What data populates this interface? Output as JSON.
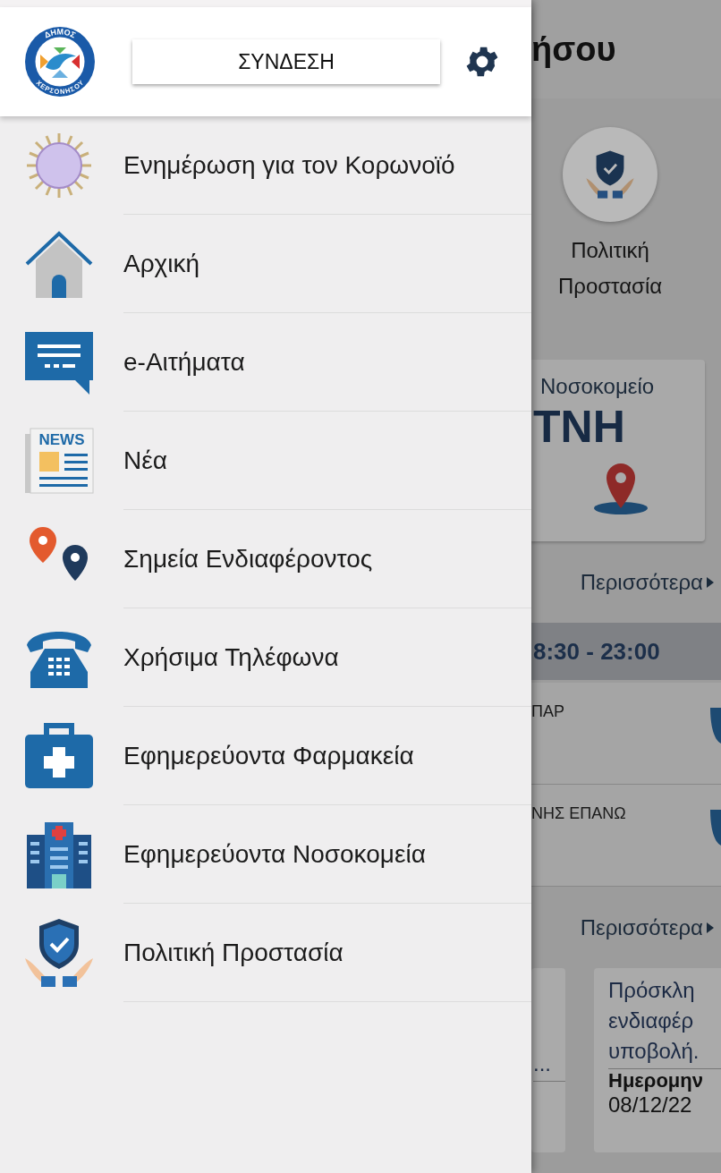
{
  "drawer": {
    "logo": {
      "top_text": "ΔΗΜΟΣ",
      "bottom_text": "ΧΕΡΣΟΝΗΣΟΥ"
    },
    "login_button": "ΣΥΝΔΕΣΗ",
    "menu": [
      {
        "label": "Ενημέρωση για τον Κορωνοϊό",
        "kind": "virus"
      },
      {
        "label": "Αρχική",
        "kind": "home"
      },
      {
        "label": "e-Αιτήματα",
        "kind": "chat"
      },
      {
        "label": "Νέα",
        "kind": "news",
        "icon_text": "NEWS"
      },
      {
        "label": "Σημεία Ενδιαφέροντος",
        "kind": "pins"
      },
      {
        "label": "Χρήσιμα Τηλέφωνα",
        "kind": "phone"
      },
      {
        "label": "Εφημερεύοντα Φαρμακεία",
        "kind": "medkit"
      },
      {
        "label": "Εφημερεύοντα Νοσοκομεία",
        "kind": "hospital"
      },
      {
        "label": "Πολιτική Προστασία",
        "kind": "shield"
      }
    ]
  },
  "background": {
    "header_title": "ήσου",
    "shortcut": {
      "lines": [
        "Πολιτική",
        "Προστασία"
      ]
    },
    "hospital_card": {
      "caption": "Νοσοκομείο",
      "name": "ΤΝΗ"
    },
    "hospital_more": "Περισσότερα",
    "hours": "8:30 - 23:00",
    "pharmacies": [
      "ΠΑΡ",
      "ΝΗΣ ΕΠΑΝΩ"
    ],
    "news_more": "Περισσότερα",
    "news_cards": [
      {
        "lines": [
          "..."
        ]
      },
      {
        "lines": [
          "Πρόσκλη",
          "ενδιαφέρ",
          "υποβολή."
        ],
        "date_label": "Ημερομην",
        "date": "08/12/22"
      }
    ]
  }
}
